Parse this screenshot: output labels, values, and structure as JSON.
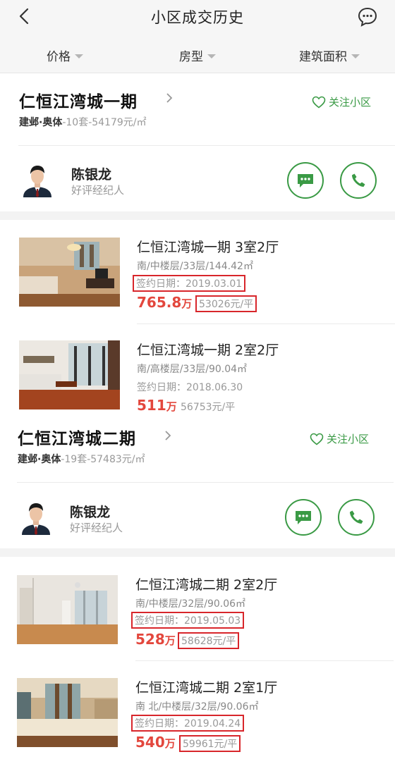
{
  "header": {
    "title": "小区成交历史",
    "filters": [
      {
        "label": "价格"
      },
      {
        "label": "房型"
      },
      {
        "label": "建筑面积"
      }
    ]
  },
  "communities": [
    {
      "name": "仁恒江湾城一期",
      "area": "建邺·奥体",
      "stats": "-10套-54179元/㎡",
      "follow_label": "关注小区",
      "agent": {
        "name": "陈银龙",
        "subtitle": "好评经纪人"
      },
      "listings": [
        {
          "title": "仁恒江湾城一期 3室2厅",
          "detail": "南/中楼层/33层/144.42㎡",
          "date": "签约日期：2019.03.01",
          "price": "765.8",
          "price_unit": "万",
          "unit_price": "53026元/平",
          "highlighted": true
        },
        {
          "title": "仁恒江湾城一期 2室2厅",
          "detail": "南/高楼层/33层/90.04㎡",
          "date": "签约日期：2018.06.30",
          "price": "511",
          "price_unit": "万",
          "unit_price": "56753元/平",
          "highlighted": false
        }
      ]
    },
    {
      "name": "仁恒江湾城二期",
      "area": "建邺·奥体",
      "stats": "-19套-57483元/㎡",
      "follow_label": "关注小区",
      "agent": {
        "name": "陈银龙",
        "subtitle": "好评经纪人"
      },
      "listings": [
        {
          "title": "仁恒江湾城二期 2室2厅",
          "detail": "南/中楼层/32层/90.06㎡",
          "date": "签约日期：2019.05.03",
          "price": "528",
          "price_unit": "万",
          "unit_price": "58628元/平",
          "highlighted": true
        },
        {
          "title": "仁恒江湾城二期 2室1厅",
          "detail": "南 北/中楼层/32层/90.06㎡",
          "date": "签约日期：2019.04.24",
          "price": "540",
          "price_unit": "万",
          "unit_price": "59961元/平",
          "highlighted": true
        }
      ]
    }
  ],
  "colors": {
    "accent_green": "#3a9a45",
    "price_red": "#e3473d",
    "highlight_border": "#d8262b"
  },
  "icons": [
    "back-arrow-icon",
    "chat-bubble-icon",
    "caret-down-icon",
    "chevron-right-icon",
    "heart-outline-icon",
    "message-icon",
    "phone-icon"
  ]
}
